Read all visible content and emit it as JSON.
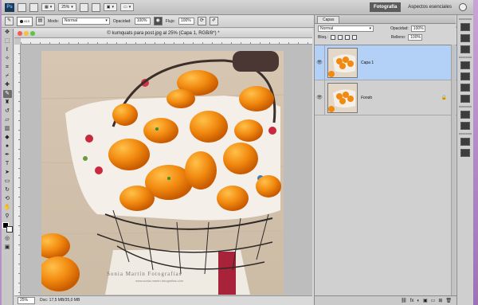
{
  "app": {
    "logo": "Ps",
    "zoom": "25%",
    "workspaces": [
      "Fotografía",
      "Aspectos esenciales"
    ],
    "active_workspace": "Fotografía"
  },
  "options": {
    "brush_size": "413",
    "mode_label": "Modo:",
    "mode_value": "Normal",
    "opacity_label": "Opacidad:",
    "opacity_value": "100%",
    "flow_label": "Flujo:",
    "flow_value": "100%"
  },
  "document": {
    "title": "© kumquats para post.jpg al 25% (Capa 1, RGB/8*) *",
    "status_zoom": "25%",
    "status_doc": "Doc: 17,5 MB/35,0 MB",
    "watermark_name": "Sonia Martín Fotografías",
    "watermark_url": "www.sonia-martin-fotografias.com"
  },
  "layers_panel": {
    "tab": "Capas",
    "blend_mode": "Normal",
    "opacity_label": "Opacidad:",
    "opacity_value": "100%",
    "lock_label": "Bloq.:",
    "fill_label": "Relleno:",
    "fill_value": "100%",
    "layers": [
      {
        "name": "Capa 1",
        "selected": true
      },
      {
        "name": "Fondo",
        "selected": false
      }
    ],
    "footer_icons": [
      "fx",
      "◐",
      "▣",
      "▭",
      "⊞",
      "🗑"
    ]
  },
  "colors": {
    "foreground": "#000000",
    "background": "#ffffff",
    "selection": "#b3d0f7"
  }
}
